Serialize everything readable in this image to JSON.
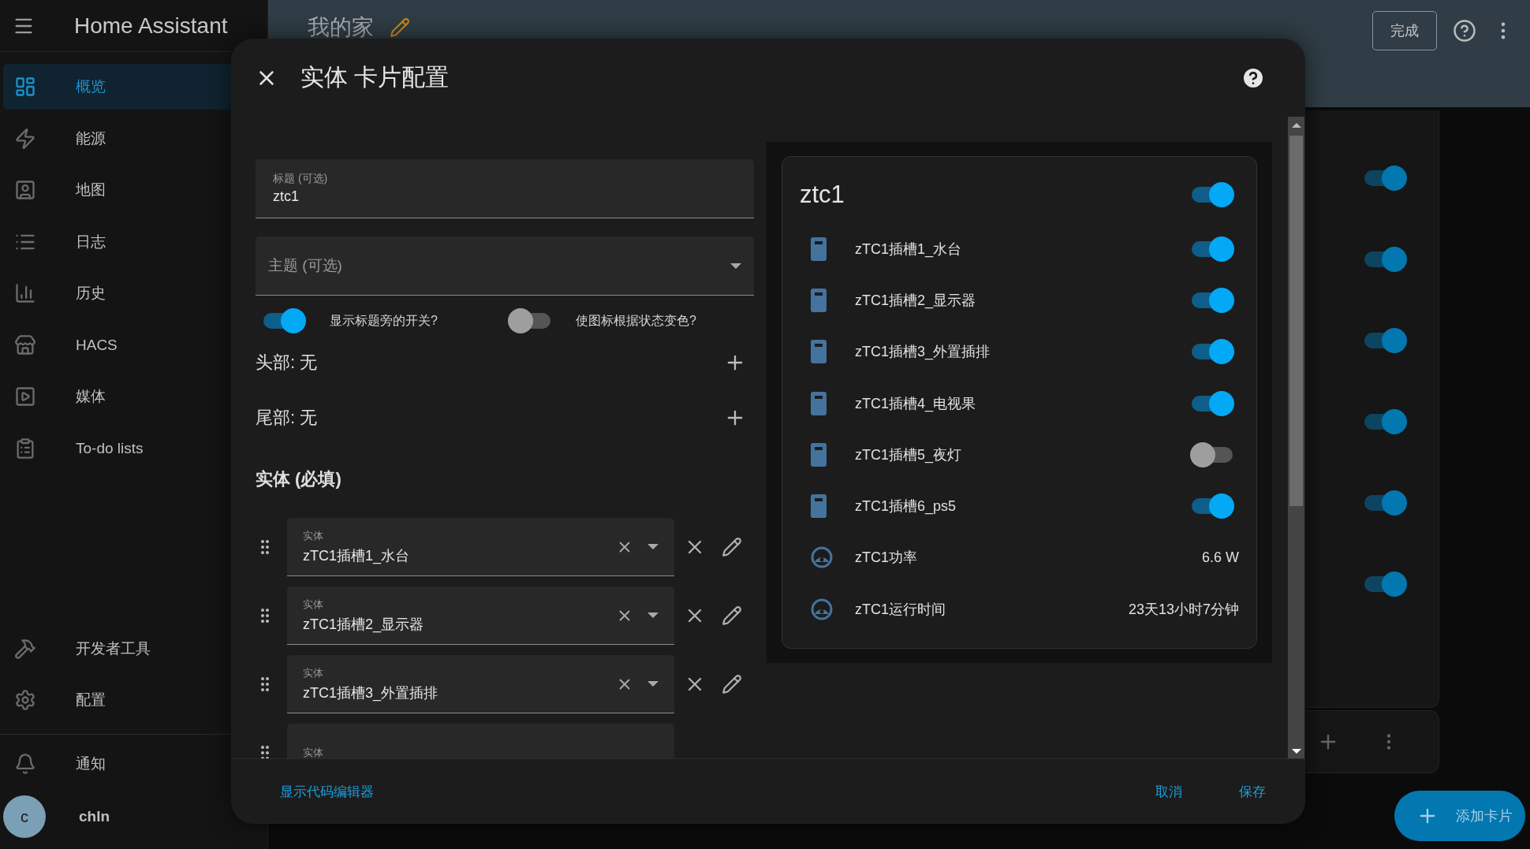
{
  "sidebar": {
    "title": "Home Assistant",
    "items": [
      {
        "label": "概览",
        "selected": true
      },
      {
        "label": "能源",
        "selected": false
      },
      {
        "label": "地图",
        "selected": false
      },
      {
        "label": "日志",
        "selected": false
      },
      {
        "label": "历史",
        "selected": false
      },
      {
        "label": "HACS",
        "selected": false
      },
      {
        "label": "媒体",
        "selected": false
      },
      {
        "label": "To-do lists",
        "selected": false
      }
    ],
    "bottom_items": [
      {
        "label": "开发者工具",
        "selected": false
      },
      {
        "label": "配置",
        "selected": false
      }
    ],
    "notifications": "通知",
    "user": {
      "initial": "c",
      "name": "chln"
    }
  },
  "topbar": {
    "title": "我的家",
    "done_button": "完成"
  },
  "background_card": {
    "toggles": [
      {
        "on": true
      },
      {
        "on": true
      },
      {
        "on": true
      },
      {
        "on": true
      },
      {
        "on": true
      },
      {
        "on": true
      }
    ]
  },
  "add_card_button": "添加卡片",
  "dialog": {
    "title": "实体 卡片配置",
    "title_field": {
      "label": "标题 (可选)",
      "value": "ztc1"
    },
    "theme_field": {
      "placeholder": "主题 (可选)"
    },
    "switches": [
      {
        "label": "显示标题旁的开关?",
        "on": true
      },
      {
        "label": "使图标根据状态变色?",
        "on": false
      }
    ],
    "sections": [
      {
        "label": "头部: 无"
      },
      {
        "label": "尾部: 无"
      }
    ],
    "entities_heading": "实体 (必填)",
    "entities": [
      {
        "label": "实体",
        "value": "zTC1插槽1_水台"
      },
      {
        "label": "实体",
        "value": "zTC1插槽2_显示器"
      },
      {
        "label": "实体",
        "value": "zTC1插槽3_外置插排"
      },
      {
        "label": "实体"
      }
    ],
    "footer": {
      "code_editor_link": "显示代码编辑器",
      "buttons": [
        "取消",
        "保存"
      ]
    }
  },
  "preview": {
    "title": "ztc1",
    "header_toggle": {
      "on": true
    },
    "rows": [
      {
        "kind": "switch",
        "name": "zTC1插槽1_水台",
        "on": true
      },
      {
        "kind": "switch",
        "name": "zTC1插槽2_显示器",
        "on": true
      },
      {
        "kind": "switch",
        "name": "zTC1插槽3_外置插排",
        "on": true
      },
      {
        "kind": "switch",
        "name": "zTC1插槽4_电视果",
        "on": true
      },
      {
        "kind": "switch",
        "name": "zTC1插槽5_夜灯",
        "on": false
      },
      {
        "kind": "switch",
        "name": "zTC1插槽6_ps5",
        "on": true
      },
      {
        "kind": "sensor",
        "name": "zTC1功率",
        "value": "6.6 W"
      },
      {
        "kind": "sensor",
        "name": "zTC1运行时间",
        "value": "23天13小时7分钟"
      }
    ]
  }
}
